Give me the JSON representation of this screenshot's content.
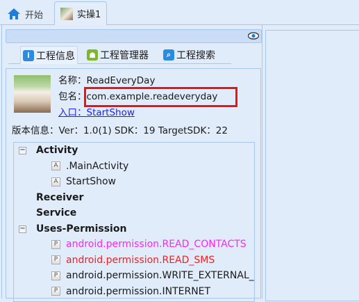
{
  "tabs": [
    {
      "label": "开始",
      "icon": "home-icon"
    },
    {
      "label": "实操1",
      "icon": "book-icon",
      "active": true
    }
  ],
  "subtabs": [
    {
      "label": "工程信息",
      "icon": "info-icon"
    },
    {
      "label": "工程管理器",
      "icon": "android-icon"
    },
    {
      "label": "工程搜索",
      "icon": "search-icon"
    }
  ],
  "info": {
    "name": "名称：ReadEveryDay",
    "package": "包名：com.example.readeveryday",
    "entry": "入口：StartShow",
    "version": "版本信息：Ver：1.0(1) SDK：19 TargetSDK：22"
  },
  "tree": [
    {
      "label": "Activity",
      "bold": true,
      "expanded": true
    },
    {
      "label": ".MainActivity",
      "icon": "A"
    },
    {
      "label": "StartShow",
      "icon": "A"
    },
    {
      "label": "Receiver",
      "bold": true
    },
    {
      "label": "Service",
      "bold": true
    },
    {
      "label": "Uses-Permission",
      "bold": true,
      "expanded": true
    },
    {
      "label": "android.permission.READ_CONTACTS",
      "icon": "P",
      "color": "#ff22ff"
    },
    {
      "label": "android.permission.READ_SMS",
      "icon": "P",
      "color": "#f02020"
    },
    {
      "label": "android.permission.WRITE_EXTERNAL_STORAGE",
      "icon": "P"
    },
    {
      "label": "android.permission.INTERNET",
      "icon": "P"
    }
  ],
  "colors": {
    "highlight_box": "#f21010",
    "link": "#2020ee"
  }
}
